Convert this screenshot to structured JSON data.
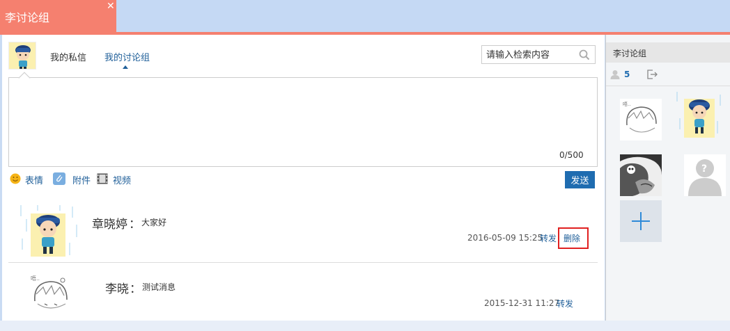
{
  "tab": {
    "title": "李讨论组",
    "close": "✕"
  },
  "nav": {
    "private_messages": "我的私信",
    "my_groups": "我的讨论组"
  },
  "search": {
    "placeholder": "请输入检索内容",
    "icon": "search-icon"
  },
  "compose": {
    "value": "",
    "counter": "0/500"
  },
  "toolbar": {
    "emoji": "表情",
    "attachment": "附件",
    "video": "视频",
    "send": "发送"
  },
  "posts": [
    {
      "author": "章晓婷",
      "separator": "：",
      "text": "大家好",
      "time": "2016-05-09 15:25",
      "forward": "转发",
      "delete": "删除"
    },
    {
      "author": "李晓",
      "separator": "：",
      "text": "测试消息",
      "time": "2015-12-31 11:27",
      "forward": "转发"
    }
  ],
  "side": {
    "title": "李讨论组",
    "member_count": "5"
  },
  "colors": {
    "accent": "#f5806f",
    "link": "#1f5f99",
    "button": "#1f6cb0",
    "highlight": "#e02020"
  }
}
